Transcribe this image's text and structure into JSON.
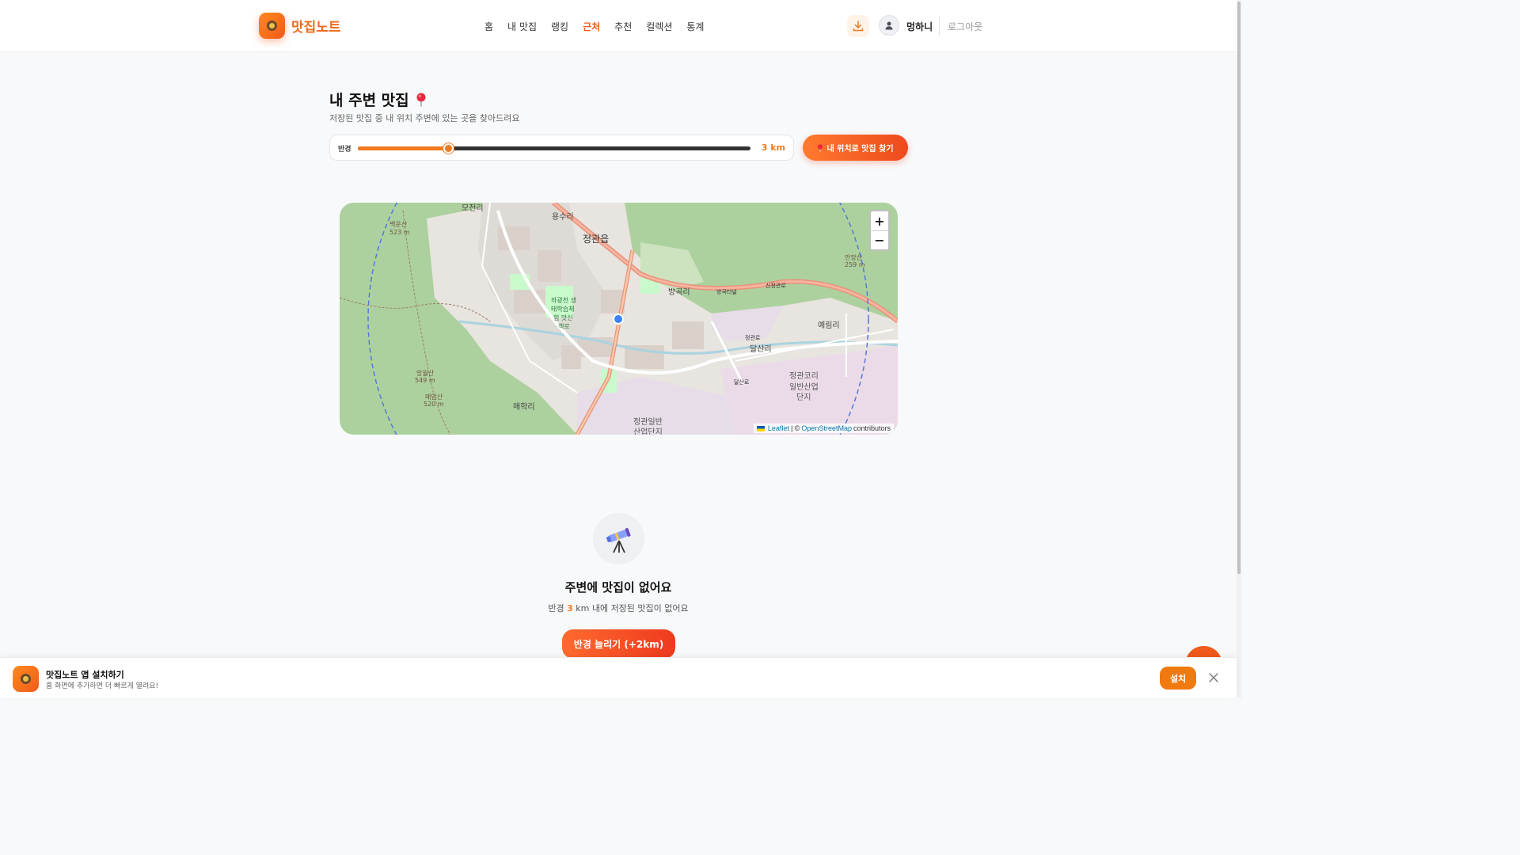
{
  "header": {
    "brand": "맛집노트",
    "nav": [
      "홈",
      "내 맛집",
      "랭킹",
      "근처",
      "추천",
      "컬렉션",
      "통계"
    ],
    "active_nav": "근처",
    "username": "멍하니",
    "logout": "로그아웃"
  },
  "page": {
    "title": "내 주변 맛집",
    "subtitle": "저장된 맛집 중 내 위치 주변에 있는 곳을 찾아드려요"
  },
  "radius": {
    "label": "반경",
    "value_text": "3 km",
    "value_km": 3,
    "fraction": 0.23
  },
  "find_button": "내 위치로 맛집 찾기",
  "map": {
    "zoom_in": "+",
    "zoom_out": "−",
    "attribution_leaflet": "Leaflet",
    "attribution_sep": "| ©",
    "attribution_osm": "OpenStreetMap",
    "attribution_tail": "contributors",
    "labels": {
      "jeonggwan": "정관읍",
      "mojeonri": "모전리",
      "yongsuri": "용수리",
      "banggokri": "방곡리",
      "yerimri": "예림리",
      "dalsanri": "달산리",
      "maehakri": "매학리",
      "industrial": "정관일반",
      "industrial2": "산업단지",
      "korea_ind": "정관코리",
      "korea_ind2": "일반산업",
      "korea_ind3": "단지",
      "ecology": "좌광천 생",
      "ecology2": "태학습체",
      "ecology3": "험 맛신",
      "ecology4": "책로",
      "mt1": "백운산",
      "mt1_h": "523 m",
      "mt2": "망월산",
      "mt2_h": "549 m",
      "mt3": "매암산",
      "mt3_h": "520 m",
      "mt4": "안장산",
      "mt4_h": "259 m",
      "road1": "신정관로",
      "road2": "방곡터널",
      "road3": "정관로",
      "road4": "달산로"
    }
  },
  "empty": {
    "title": "주변에 맛집이 없어요",
    "sub_prefix": "반경",
    "sub_value": "3",
    "sub_suffix": "km 내에 저장된 맛집이 없어요",
    "button": "반경 늘리기 (+2km)"
  },
  "install": {
    "title": "맛집노트 앱 설치하기",
    "sub": "홈 화면에 추가하면 더 빠르게 열려요!",
    "button": "설치"
  },
  "colors": {
    "accent": "#f07a20",
    "accent_dark": "#ee4a1e"
  }
}
